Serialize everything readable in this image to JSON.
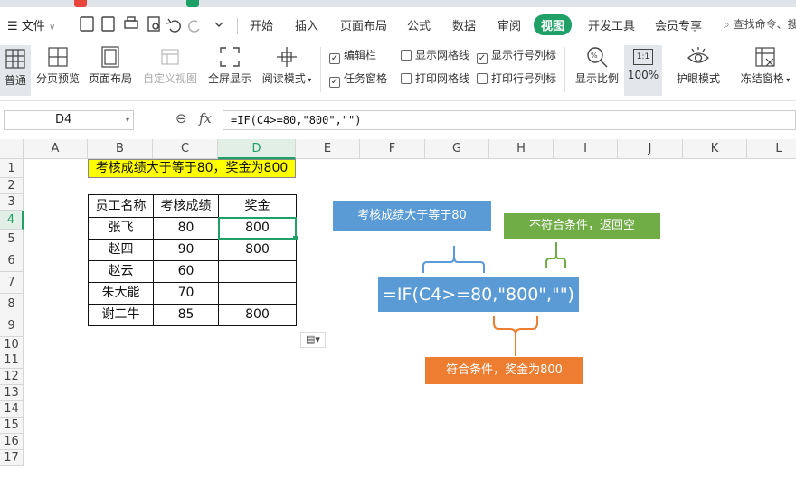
{
  "menu": {
    "file_label": "文件",
    "tabs": [
      "开始",
      "插入",
      "页面布局",
      "公式",
      "数据",
      "审阅",
      "视图",
      "开发工具",
      "会员专享"
    ],
    "active_tab": "视图",
    "search_placeholder": "查找命令、搜"
  },
  "ribbon": {
    "normal": "普通",
    "page_break_preview": "分页预览",
    "page_layout": "页面布局",
    "custom_view": "自定义视图",
    "full_screen": "全屏显示",
    "reading_mode": "阅读模式",
    "edit_bar": "编辑栏",
    "task_pane": "任务窗格",
    "show_gridlines": "显示网格线",
    "print_gridlines": "打印网格线",
    "show_row_col_headers": "显示行号列标",
    "print_row_col_headers": "打印行号列标",
    "zoom_ratio": "显示比例",
    "zoom_100": "100%",
    "zoom_100_icon": "1:1",
    "eye_protection": "护眼模式",
    "freeze_panes": "冻结窗格"
  },
  "formula_bar": {
    "name_box": "D4",
    "fx": "fx",
    "formula": "=IF(C4>=80,\"800\",\"\")"
  },
  "columns": [
    "A",
    "B",
    "C",
    "D",
    "E",
    "F",
    "G",
    "H",
    "I",
    "J",
    "K",
    "L"
  ],
  "rows": [
    "1",
    "2",
    "3",
    "4",
    "5",
    "6",
    "7",
    "8",
    "9",
    "10",
    "11",
    "12",
    "13",
    "14",
    "15",
    "16",
    "17"
  ],
  "sheet": {
    "title": "考核成绩大于等于80，奖金为800",
    "headers": [
      "员工名称",
      "考核成绩",
      "奖金"
    ],
    "data": [
      [
        "张飞",
        "80",
        "800"
      ],
      [
        "赵四",
        "90",
        "800"
      ],
      [
        "赵云",
        "60",
        ""
      ],
      [
        "朱大能",
        "70",
        ""
      ],
      [
        "谢二牛",
        "85",
        "800"
      ]
    ]
  },
  "annotations": {
    "condition": "考核成绩大于等于80",
    "false_value": "不符合条件，返回空",
    "formula": "=IF(C4>=80,\"800\",\"\")",
    "true_value": "符合条件，奖金为800"
  },
  "colors": {
    "accent_green": "#1fa067",
    "title_yellow": "#ffff00",
    "note_blue": "#5b9bd5",
    "note_green": "#70ad47",
    "note_orange": "#ed7d31"
  }
}
